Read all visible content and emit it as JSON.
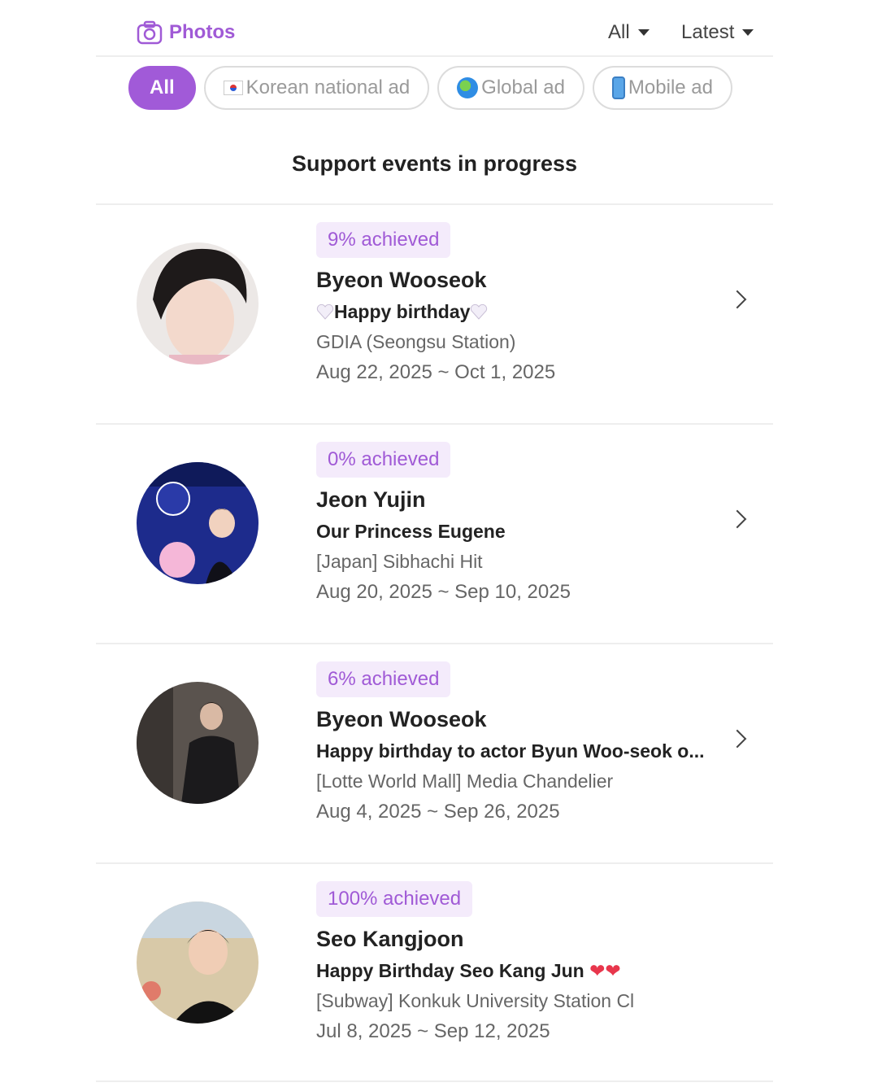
{
  "header": {
    "brand_label": "Photos",
    "filter_all": "All",
    "filter_sort": "Latest"
  },
  "chips": [
    {
      "label": "All"
    },
    {
      "label": "Korean national ad",
      "icon": "korean-flag-icon"
    },
    {
      "label": "Global ad",
      "icon": "globe-icon"
    },
    {
      "label": "Mobile ad",
      "icon": "mobile-phone-icon"
    }
  ],
  "section_title": "Support events in progress",
  "events": [
    {
      "badge": "9% achieved",
      "progress_percent": 9,
      "name": "Byeon Wooseok",
      "message": "Happy birthday",
      "venue": "GDIA (Seongsu Station)",
      "dates": "Aug 22, 2025 ~ Oct 1, 2025"
    },
    {
      "badge": "0% achieved",
      "progress_percent": 0,
      "name": "Jeon Yujin",
      "message": "Our Princess Eugene",
      "venue": "[Japan] Sibhachi Hit",
      "dates": "Aug 20, 2025 ~ Sep 10, 2025"
    },
    {
      "badge": "6% achieved",
      "progress_percent": 6,
      "name": "Byeon Wooseok",
      "message": "Happy birthday to actor Byun Woo-seok o...",
      "venue": "[Lotte World Mall] Media Chandelier",
      "dates": "Aug 4, 2025 ~ Sep 26, 2025"
    },
    {
      "badge": "100% achieved",
      "progress_percent": 100,
      "name": "Seo Kangjoon",
      "message": "Happy Birthday Seo Kang Jun",
      "venue": "[Subway] Konkuk University Station Cl",
      "dates": "Jul 8, 2025 ~ Sep 12, 2025"
    }
  ],
  "colors": {
    "accent": "#a15ad8",
    "badge_bg": "#f4ebfb",
    "divider": "#eeeeee"
  }
}
